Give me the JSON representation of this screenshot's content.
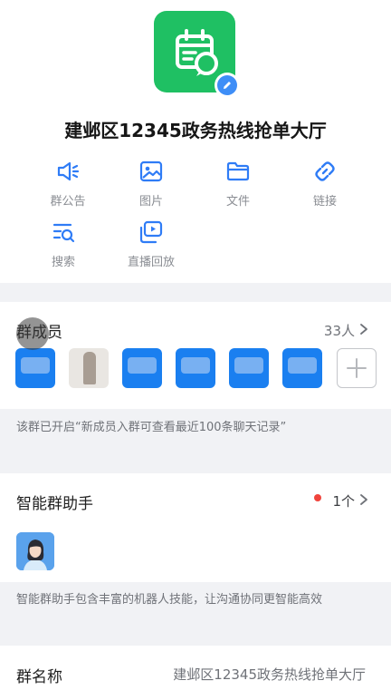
{
  "group": {
    "name": "建邺区12345政务热线抢单大厅",
    "avatar_icon": "calendar-chat-icon",
    "avatar_color": "#1fc063",
    "edit_icon": "pencil-icon"
  },
  "functions": [
    {
      "label": "群公告",
      "icon": "megaphone-icon"
    },
    {
      "label": "图片",
      "icon": "image-icon"
    },
    {
      "label": "文件",
      "icon": "folder-icon"
    },
    {
      "label": "链接",
      "icon": "link-icon"
    },
    {
      "label": "搜索",
      "icon": "search-list-icon"
    },
    {
      "label": "直播回放",
      "icon": "replay-icon"
    }
  ],
  "members": {
    "title": "群成员",
    "count": "33人",
    "notice": "该群已开启“新成员入群可查看最近100条聊天记录”"
  },
  "assistant": {
    "title": "智能群助手",
    "count": "1个",
    "description": "智能群助手包含丰富的机器人技能，让沟通协同更智能高效"
  },
  "group_name_row": {
    "label": "群名称",
    "value": "建邺区12345政务热线抢单大厅"
  },
  "colors": {
    "accent": "#3e8ef7",
    "icon_blue": "#2f7cf6",
    "member_blue": "#1a7ff0",
    "badge_red": "#f0443c"
  }
}
